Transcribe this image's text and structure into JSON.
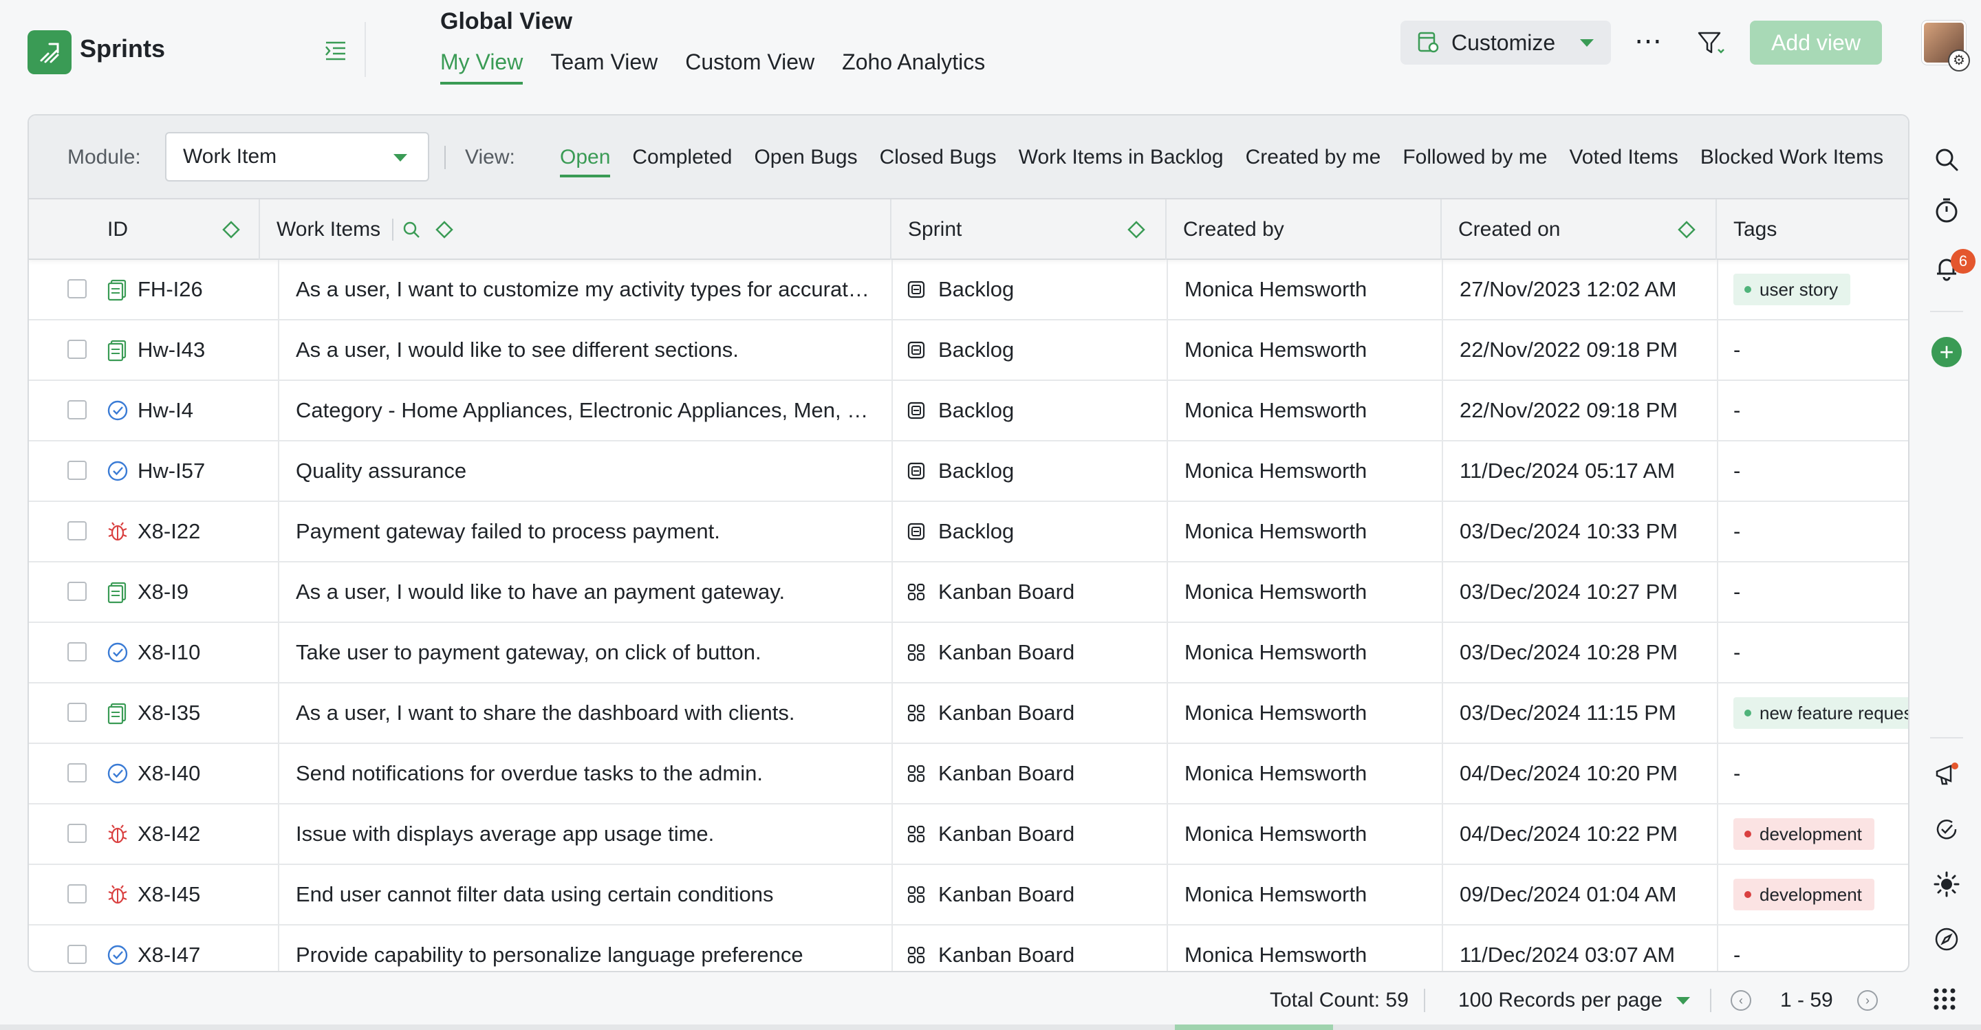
{
  "app": {
    "name": "Sprints",
    "logo_icon": "sprints-logo-icon",
    "accent": "#3a9b55"
  },
  "header": {
    "title": "Global View",
    "tabs": [
      {
        "label": "My View",
        "active": true
      },
      {
        "label": "Team View",
        "active": false
      },
      {
        "label": "Custom View",
        "active": false
      },
      {
        "label": "Zoho Analytics",
        "active": false
      }
    ],
    "customize_label": "Customize",
    "add_view_label": "Add view"
  },
  "filters": {
    "module_label": "Module:",
    "module_value": "Work Item",
    "view_label": "View:",
    "views": [
      {
        "label": "Open",
        "active": true
      },
      {
        "label": "Completed",
        "active": false
      },
      {
        "label": "Open Bugs",
        "active": false
      },
      {
        "label": "Closed Bugs",
        "active": false
      },
      {
        "label": "Work Items in Backlog",
        "active": false
      },
      {
        "label": "Created by me",
        "active": false
      },
      {
        "label": "Followed by me",
        "active": false
      },
      {
        "label": "Voted Items",
        "active": false
      },
      {
        "label": "Blocked Work Items",
        "active": false
      }
    ]
  },
  "table": {
    "columns": {
      "id": "ID",
      "work_items": "Work Items",
      "sprint": "Sprint",
      "created_by": "Created by",
      "created_on": "Created on",
      "tags": "Tags"
    },
    "rows": [
      {
        "type": "story",
        "id": "FH-I26",
        "title": "As a user, I want to customize my activity types for accurat…",
        "sprint": "Backlog",
        "sprint_icon": "backlog-icon",
        "created_by": "Monica Hemsworth",
        "created_on": "27/Nov/2023 12:02 AM",
        "tag": {
          "label": "user story",
          "color": "#4fb37a",
          "bg": "#e6f4ec"
        }
      },
      {
        "type": "story",
        "id": "Hw-I43",
        "title": "As a user, I would like to see different sections.",
        "sprint": "Backlog",
        "sprint_icon": "backlog-icon",
        "created_by": "Monica Hemsworth",
        "created_on": "22/Nov/2022 09:18 PM",
        "tag_text": "-"
      },
      {
        "type": "task",
        "id": "Hw-I4",
        "title": "Category - Home Appliances, Electronic Appliances, Men, …",
        "sprint": "Backlog",
        "sprint_icon": "backlog-icon",
        "created_by": "Monica Hemsworth",
        "created_on": "22/Nov/2022 09:18 PM",
        "tag_text": "-"
      },
      {
        "type": "task",
        "id": "Hw-I57",
        "title": "Quality assurance",
        "sprint": "Backlog",
        "sprint_icon": "backlog-icon",
        "created_by": "Monica Hemsworth",
        "created_on": "11/Dec/2024 05:17 AM",
        "tag_text": "-"
      },
      {
        "type": "bug",
        "id": "X8-I22",
        "title": "Payment gateway failed to process payment.",
        "sprint": "Backlog",
        "sprint_icon": "backlog-icon",
        "created_by": "Monica Hemsworth",
        "created_on": "03/Dec/2024 10:33 PM",
        "tag_text": "-"
      },
      {
        "type": "story",
        "id": "X8-I9",
        "title": "As a user, I would like to have an payment gateway.",
        "sprint": "Kanban Board",
        "sprint_icon": "kanban-icon",
        "created_by": "Monica Hemsworth",
        "created_on": "03/Dec/2024 10:27 PM",
        "tag_text": "-"
      },
      {
        "type": "task",
        "id": "X8-I10",
        "title": "Take user to payment gateway, on click of button.",
        "sprint": "Kanban Board",
        "sprint_icon": "kanban-icon",
        "created_by": "Monica Hemsworth",
        "created_on": "03/Dec/2024 10:28 PM",
        "tag_text": "-"
      },
      {
        "type": "story",
        "id": "X8-I35",
        "title": "As a user, I want to share the dashboard with clients.",
        "sprint": "Kanban Board",
        "sprint_icon": "kanban-icon",
        "created_by": "Monica Hemsworth",
        "created_on": "03/Dec/2024 11:15 PM",
        "tag": {
          "label": "new feature request",
          "color": "#4fb37a",
          "bg": "#e6f4ec"
        }
      },
      {
        "type": "task",
        "id": "X8-I40",
        "title": "Send notifications for overdue tasks to the admin.",
        "sprint": "Kanban Board",
        "sprint_icon": "kanban-icon",
        "created_by": "Monica Hemsworth",
        "created_on": "04/Dec/2024 10:20 PM",
        "tag_text": "-"
      },
      {
        "type": "bug",
        "id": "X8-I42",
        "title": "Issue with displays average app usage time.",
        "sprint": "Kanban Board",
        "sprint_icon": "kanban-icon",
        "created_by": "Monica Hemsworth",
        "created_on": "04/Dec/2024 10:22 PM",
        "tag": {
          "label": "development",
          "color": "#d94040",
          "bg": "#fbe3e3"
        }
      },
      {
        "type": "bug",
        "id": "X8-I45",
        "title": "End user cannot filter data using certain conditions",
        "sprint": "Kanban Board",
        "sprint_icon": "kanban-icon",
        "created_by": "Monica Hemsworth",
        "created_on": "09/Dec/2024 01:04 AM",
        "tag": {
          "label": "development",
          "color": "#d94040",
          "bg": "#fbe3e3"
        }
      },
      {
        "type": "task",
        "id": "X8-I47",
        "title": "Provide capability to personalize language preference",
        "sprint": "Kanban Board",
        "sprint_icon": "kanban-icon",
        "created_by": "Monica Hemsworth",
        "created_on": "11/Dec/2024 03:07 AM",
        "tag_text": "-"
      }
    ]
  },
  "footer": {
    "total_count": "Total Count: 59",
    "per_page": "100 Records per page",
    "range": "1 - 59"
  },
  "rail": {
    "notification_count": "6"
  }
}
